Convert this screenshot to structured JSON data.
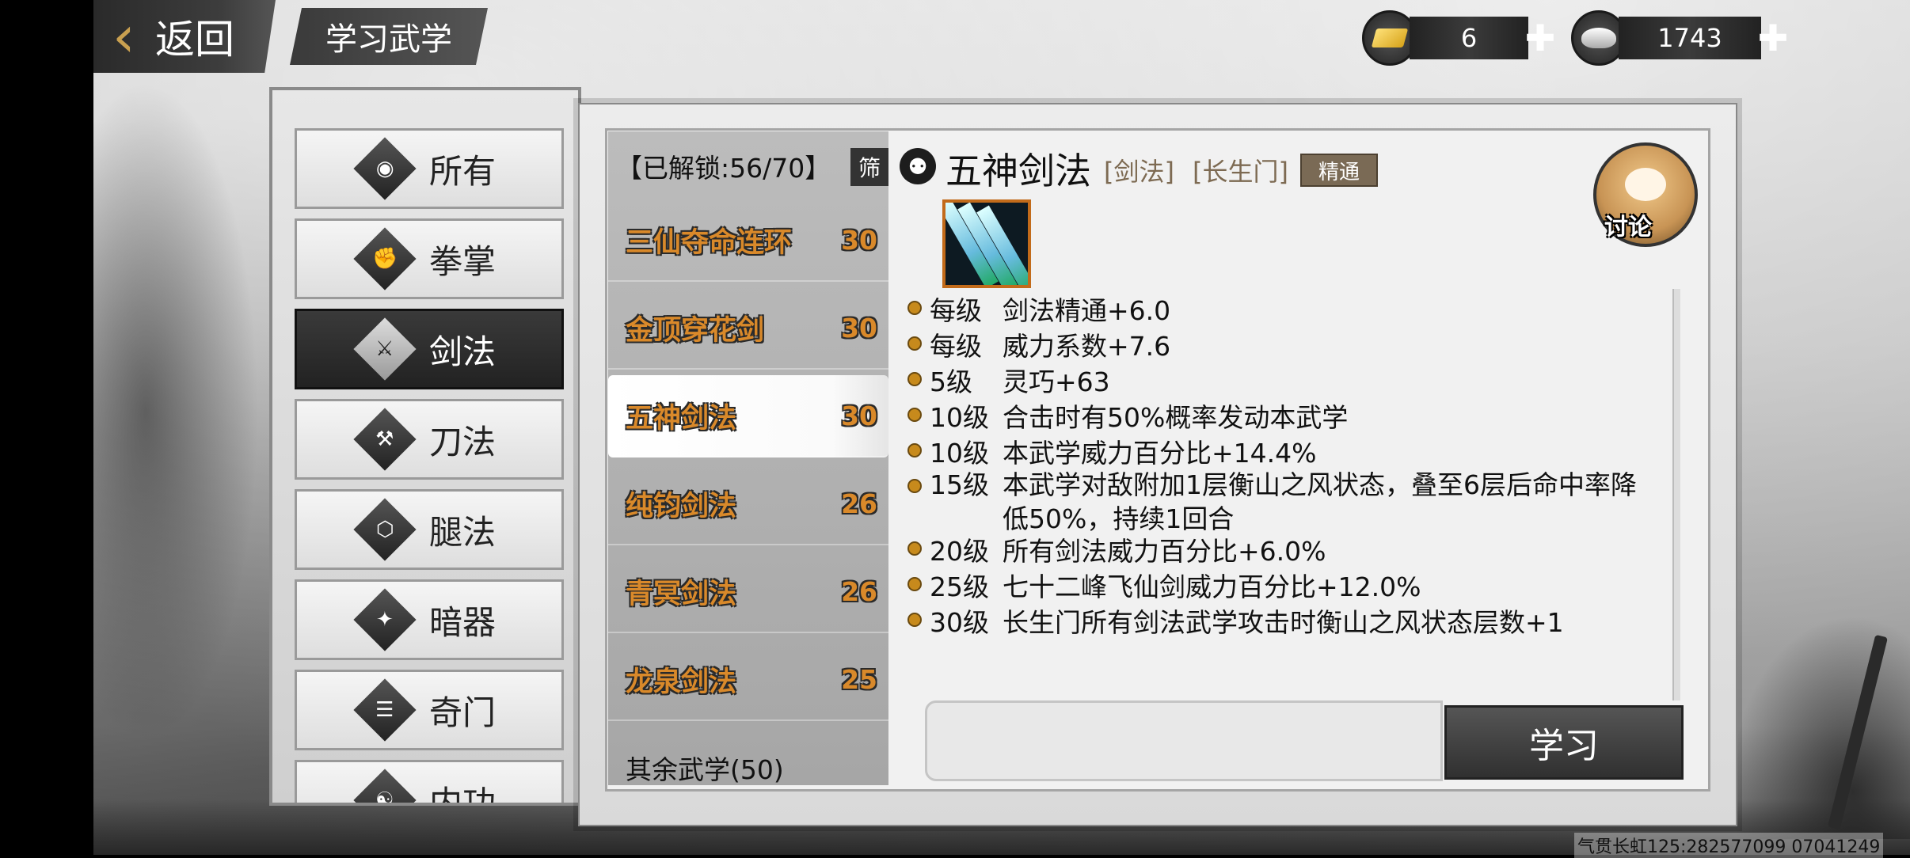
{
  "header": {
    "back_label": "返回",
    "page_title": "学习武学",
    "gold_count": "6",
    "silver_count": "1743"
  },
  "categories": [
    {
      "label": "所有",
      "icon": "meditation-icon",
      "active": false
    },
    {
      "label": "拳掌",
      "icon": "fist-icon",
      "active": false
    },
    {
      "label": "剑法",
      "icon": "sword-icon",
      "active": true
    },
    {
      "label": "刀法",
      "icon": "blade-icon",
      "active": false
    },
    {
      "label": "腿法",
      "icon": "boot-icon",
      "active": false
    },
    {
      "label": "暗器",
      "icon": "shuriken-icon",
      "active": false
    },
    {
      "label": "奇门",
      "icon": "scroll-icon",
      "active": false
    },
    {
      "label": "内功",
      "icon": "inner-power-icon",
      "active": false
    }
  ],
  "skill_list": {
    "unlock_label": "【已解锁:56/70】",
    "filter_label": "筛",
    "items": [
      {
        "name": "三仙夺命连环",
        "level": "30",
        "selected": false
      },
      {
        "name": "金顶穿花剑",
        "level": "30",
        "selected": false
      },
      {
        "name": "五神剑法",
        "level": "30",
        "selected": true
      },
      {
        "name": "纯钧剑法",
        "level": "26",
        "selected": false
      },
      {
        "name": "青冥剑法",
        "level": "26",
        "selected": false
      },
      {
        "name": "龙泉剑法",
        "level": "25",
        "selected": false
      }
    ],
    "others_label": "其余武学(50)"
  },
  "detail": {
    "title": "五神剑法",
    "tag_type": "[剑法]",
    "tag_sect": "[长生门]",
    "badge": "精通",
    "discuss_label": "讨论",
    "attributes": [
      {
        "level": "每级",
        "text": "剑法精通+6.0"
      },
      {
        "level": "每级",
        "text": "威力系数+7.6"
      },
      {
        "level": "5级",
        "text": "灵巧+63"
      },
      {
        "level": "10级",
        "text": "合击时有50%概率发动本武学"
      },
      {
        "level": "10级",
        "text": "本武学威力百分比+14.4%"
      },
      {
        "level": "15级",
        "text": "本武学对敌附加1层衡山之风状态，叠至6层后命中率降低50%，持续1回合"
      },
      {
        "level": "20级",
        "text": "所有剑法威力百分比+6.0%"
      },
      {
        "level": "25级",
        "text": "七十二峰飞仙剑威力百分比+12.0%"
      },
      {
        "level": "30级",
        "text": "长生门所有剑法武学攻击时衡山之风状态层数+1"
      }
    ],
    "learn_label": "学习"
  },
  "footer_text": "气贯长虹125:282577099 07041249",
  "colors": {
    "skill_name": "#d9892a",
    "badge_bg": "#7a6a55",
    "accent_gold": "#c9a050"
  }
}
